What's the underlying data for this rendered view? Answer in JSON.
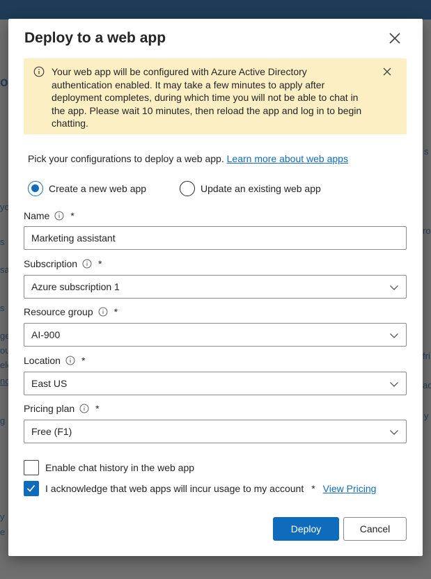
{
  "background": {
    "fragments": [
      "ou",
      "yo",
      "s",
      "sa",
      "s",
      "ge",
      "ou",
      "elo",
      "no",
      "g",
      "y",
      "e l",
      "s",
      "ro",
      "fri",
      "ad",
      "y"
    ]
  },
  "dialog": {
    "title": "Deploy to a web app",
    "banner": {
      "text": "Your web app will be configured with Azure Active Directory authentication enabled. It may take a few minutes to apply after deployment completes, during which time you will not be able to chat in the app. Please wait 10 minutes, then reload the app and log in to begin chatting.",
      "color": "#fcefc3"
    },
    "intro": {
      "text": "Pick your configurations to deploy a web app.",
      "link": "Learn more about web apps"
    },
    "mode": {
      "options": [
        {
          "label": "Create a new web app",
          "selected": true
        },
        {
          "label": "Update an existing web app",
          "selected": false
        }
      ]
    },
    "fields": {
      "name": {
        "label": "Name",
        "required": "*",
        "value": "Marketing assistant"
      },
      "subscription": {
        "label": "Subscription",
        "required": "*",
        "value": "Azure subscription 1"
      },
      "resource_group": {
        "label": "Resource group",
        "required": "*",
        "value": "AI-900"
      },
      "location": {
        "label": "Location",
        "required": "*",
        "value": "East US"
      },
      "pricing_plan": {
        "label": "Pricing plan",
        "required": "*",
        "value": "Free (F1)"
      }
    },
    "chat_history": {
      "label": "Enable chat history in the web app",
      "checked": false
    },
    "acknowledge": {
      "label": "I acknowledge that web apps will incur usage to my account",
      "required": "*",
      "link": "View Pricing",
      "checked": true
    },
    "buttons": {
      "deploy": "Deploy",
      "cancel": "Cancel"
    },
    "accent_color": "#0f6cbd"
  }
}
